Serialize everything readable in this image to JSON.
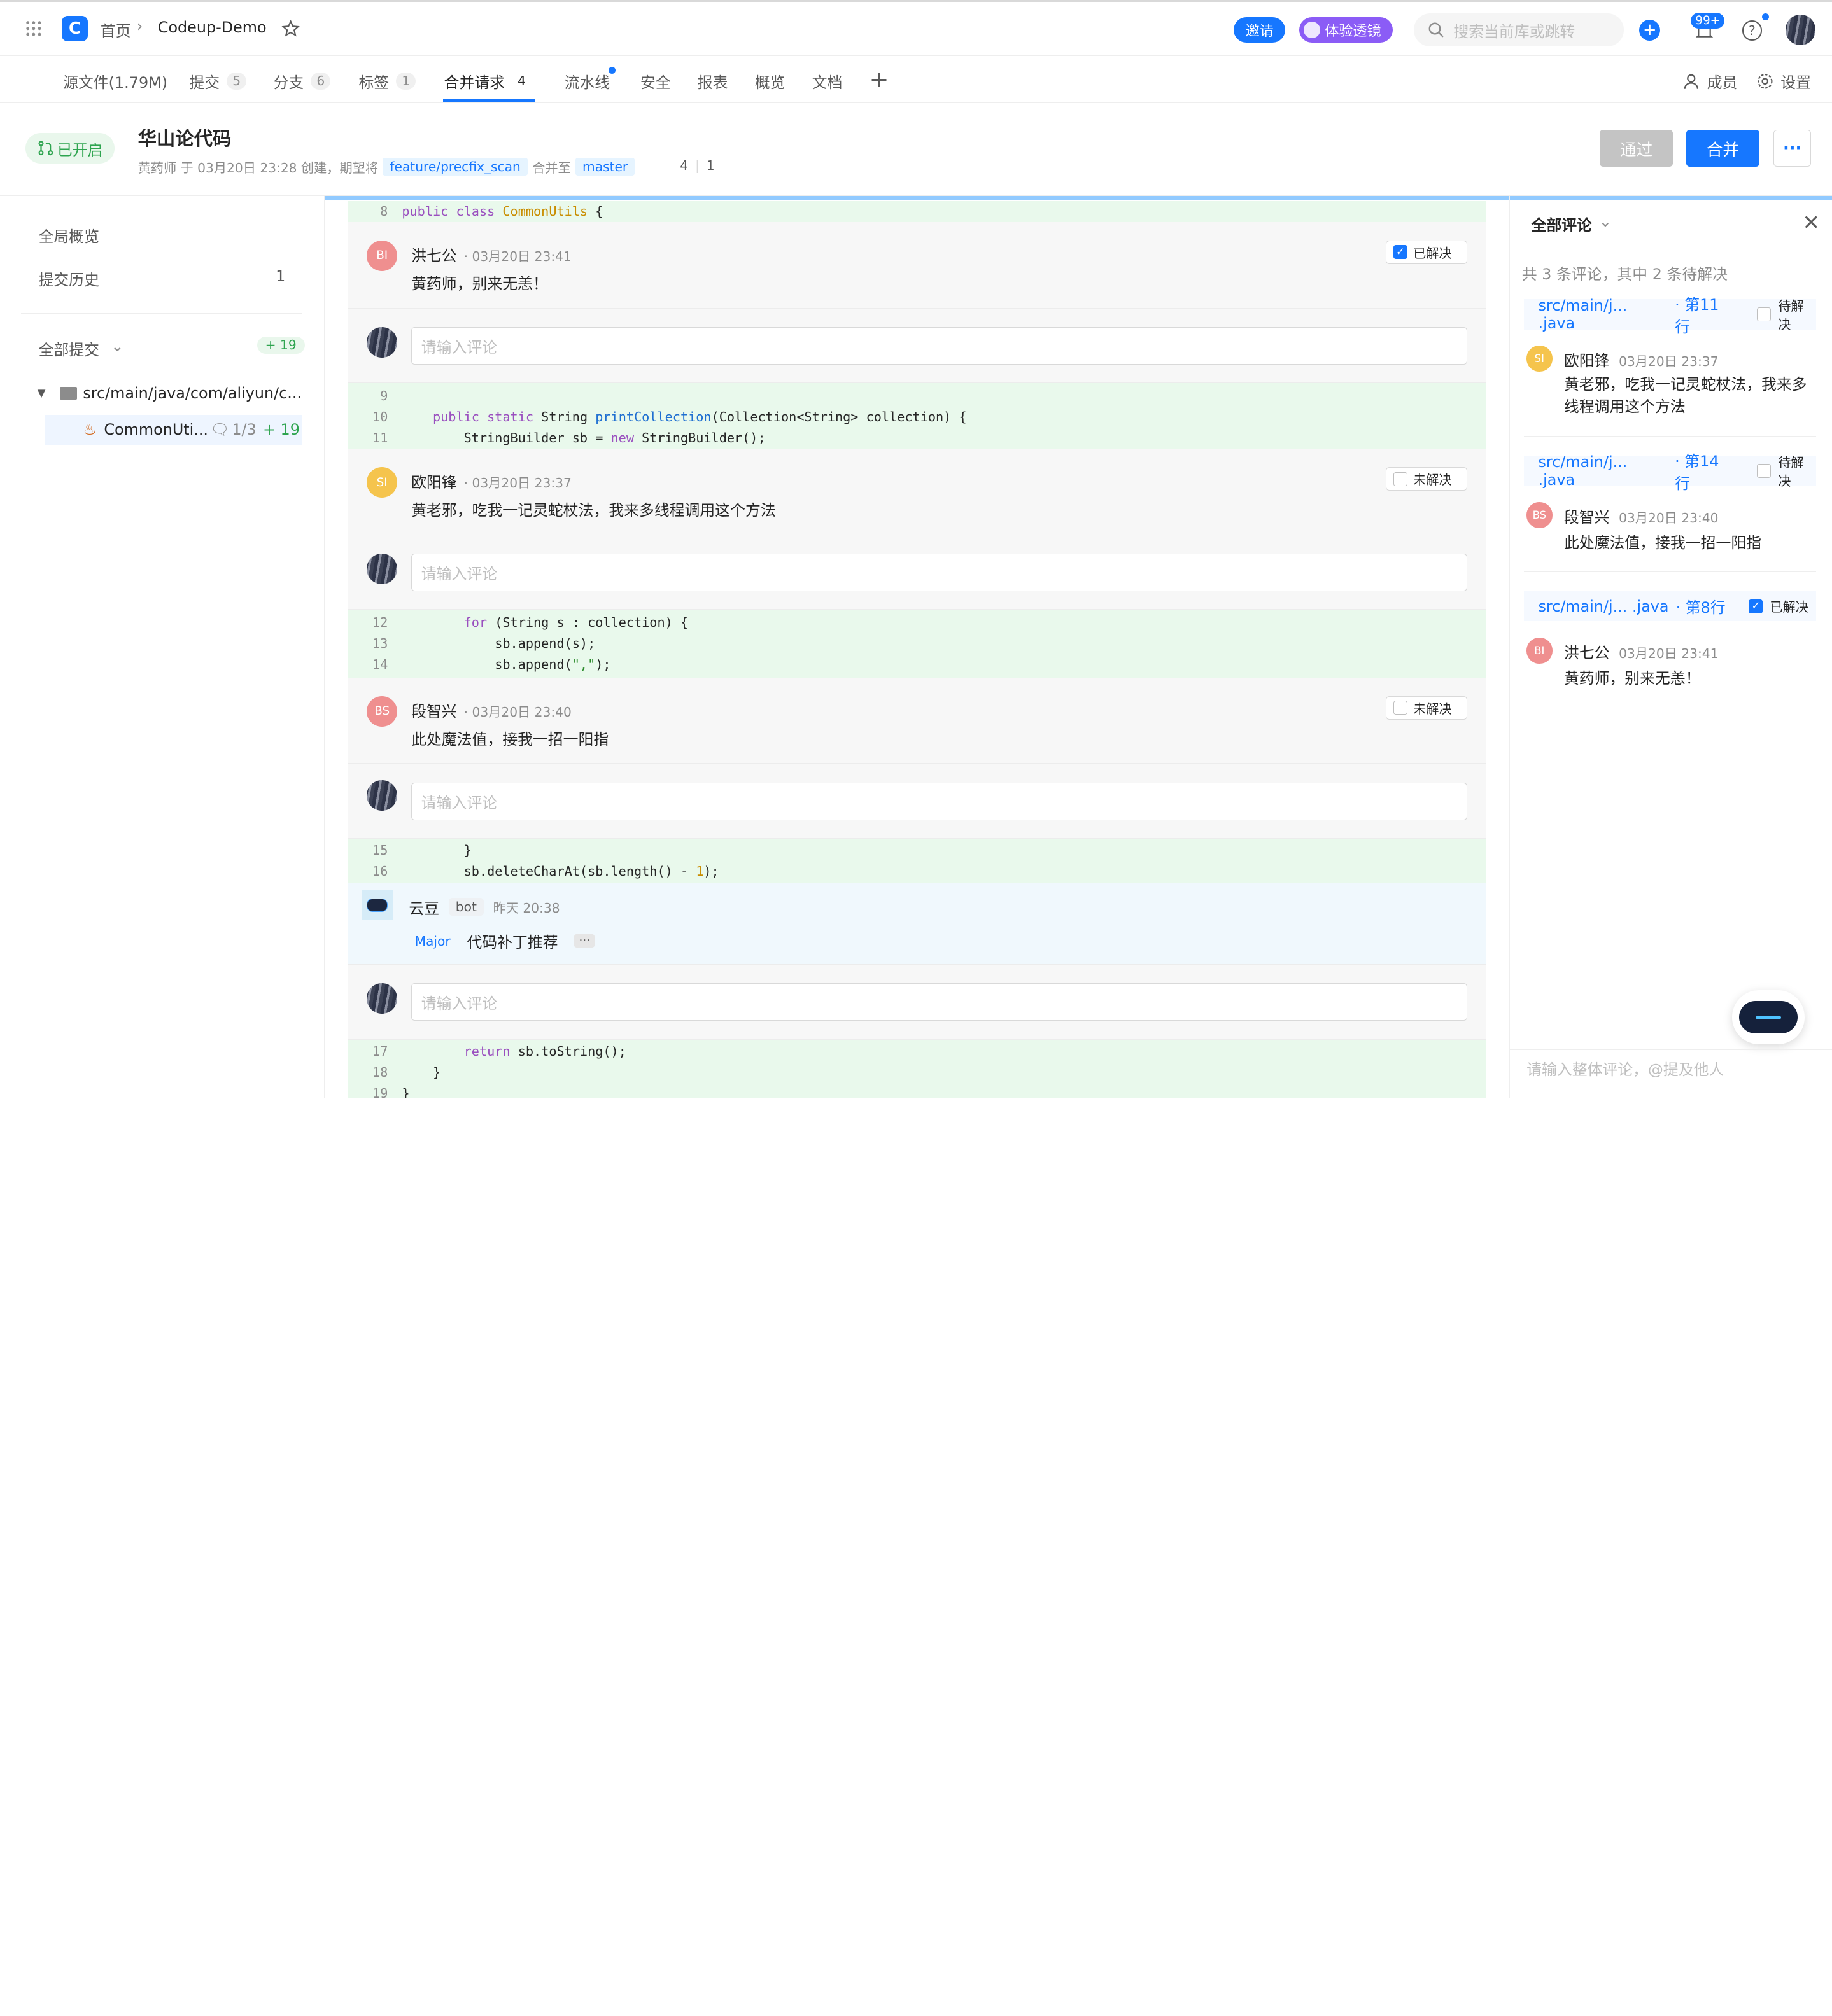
{
  "topbar": {
    "home": "首页",
    "repo": "Codeup-Demo",
    "invite": "邀请",
    "lens": "体验透镜",
    "search_placeholder": "搜索当前库或跳转",
    "notif_badge": "99+"
  },
  "tabs": [
    {
      "label": "源文件(1.79M)",
      "count": ""
    },
    {
      "label": "提交",
      "count": "5"
    },
    {
      "label": "分支",
      "count": "6"
    },
    {
      "label": "标签",
      "count": "1"
    },
    {
      "label": "合并请求",
      "count": "4"
    },
    {
      "label": "流水线",
      "count": ""
    },
    {
      "label": "安全",
      "count": ""
    },
    {
      "label": "报表",
      "count": ""
    },
    {
      "label": "概览",
      "count": ""
    },
    {
      "label": "文档",
      "count": ""
    }
  ],
  "tabs_right": {
    "members": "成员",
    "settings": "设置"
  },
  "mr": {
    "status": "已开启",
    "title": "华山论代码",
    "meta_prefix": "黄药师 于 03月20日 23:28 创建，期望将",
    "source_branch": "feature/precfix_scan",
    "merge_to": "合并至",
    "target_branch": "master",
    "stat_a": "4",
    "stat_b": "1",
    "approve": "通过",
    "merge": "合并",
    "more": "···"
  },
  "sidebar": {
    "overview": "全局概览",
    "history": "提交历史",
    "history_count": "1",
    "all_commits": "全部提交",
    "all_commits_badge": "+ 19",
    "folder": "src/main/java/com/aliyun/c...",
    "file": "CommonUti...",
    "file_comments": "1/3",
    "file_added": "+ 19"
  },
  "diff": {
    "line8": {
      "num": "8",
      "code": "public class CommonUtils {"
    },
    "c1": {
      "avatar": "BI",
      "name": "洪七公",
      "time": "· 03月20日 23:41",
      "text": "黄药师，别来无恙！",
      "status": "已解决"
    },
    "input_placeholder": "请输入评论",
    "block2": [
      {
        "num": "9",
        "code": ""
      },
      {
        "num": "10",
        "code": "    public static String printCollection(Collection<String> collection) {"
      },
      {
        "num": "11",
        "code": "        StringBuilder sb = new StringBuilder();"
      }
    ],
    "c2": {
      "avatar": "SI",
      "name": "欧阳锋",
      "time": "· 03月20日 23:37",
      "text": "黄老邪，吃我一记灵蛇杖法，我来多线程调用这个方法",
      "status": "未解决"
    },
    "block3": [
      {
        "num": "12",
        "code": "        for (String s : collection) {"
      },
      {
        "num": "13",
        "code": "            sb.append(s);"
      },
      {
        "num": "14",
        "code": "            sb.append(\",\");"
      }
    ],
    "c3": {
      "avatar": "BS",
      "name": "段智兴",
      "time": "· 03月20日 23:40",
      "text": "此处魔法值，接我一招一阳指",
      "status": "未解决"
    },
    "block4": [
      {
        "num": "15",
        "code": "        }"
      },
      {
        "num": "16",
        "code": "        sb.deleteCharAt(sb.length() - 1);"
      }
    ],
    "bot": {
      "name": "云豆",
      "tag": "bot",
      "time": "昨天 20:38",
      "severity": "Major",
      "text": "代码补丁推荐",
      "more": "···"
    },
    "block5": [
      {
        "num": "17",
        "code": "        return sb.toString();"
      },
      {
        "num": "18",
        "code": "    }"
      },
      {
        "num": "19",
        "code": "}"
      }
    ]
  },
  "rpanel": {
    "filter": "全部评论",
    "summary": "共 3 条评论，其中 2 条待解决",
    "items": [
      {
        "path": "src/main/j... .java",
        "line": "· 第11行",
        "status": "待解决",
        "resolved": false,
        "avatar": "SI",
        "name": "欧阳锋",
        "time": "03月20日 23:37",
        "text": "黄老邪，吃我一记灵蛇杖法，我来多线程调用这个方法"
      },
      {
        "path": "src/main/j... .java",
        "line": "· 第14行",
        "status": "待解决",
        "resolved": false,
        "avatar": "BS",
        "name": "段智兴",
        "time": "03月20日 23:40",
        "text": "此处魔法值，接我一招一阳指"
      },
      {
        "path": "src/main/j... .java",
        "line": "· 第8行",
        "status": "已解决",
        "resolved": true,
        "avatar": "BI",
        "name": "洪七公",
        "time": "03月20日 23:41",
        "text": "黄药师，别来无恙！"
      }
    ],
    "bottom_placeholder": "请输入整体评论，@提及他人"
  },
  "colors": {
    "accent": "#1677ff",
    "added_bg": "#e9f9ec",
    "open_green": "#2ea44f"
  }
}
